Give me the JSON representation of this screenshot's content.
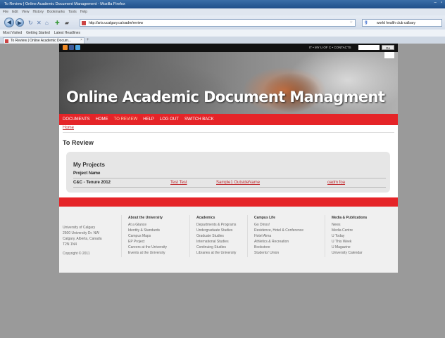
{
  "browser": {
    "window_title": "To Review | Online Academic Document Management - Mozilla Firefox",
    "menu": [
      "File",
      "Edit",
      "View",
      "History",
      "Bookmarks",
      "Tools",
      "Help"
    ],
    "url": "http://arts.ucalgary.ca/oadm/review",
    "search_text": "world health club calbary",
    "bookmarks": [
      "Most Visited",
      "Getting Started",
      "Latest Headlines"
    ],
    "tab_title": "To Review | Online Academic Docum..."
  },
  "site": {
    "top_links": "IT • MY U OF C • CONTACTS",
    "go_label": "Go",
    "title": "Online Academic Document Managment",
    "nav": [
      "DOCUMENTS",
      "HOME",
      "TO REVIEW",
      "HELP",
      "LOG OUT",
      "SWITCH BACK"
    ],
    "active_nav": "TO REVIEW",
    "breadcrumb": "Home",
    "page_title": "To Review",
    "accent": "#e52428"
  },
  "projects": {
    "heading": "My Projects",
    "column_header": "Project Name",
    "rows": [
      {
        "name": "C&C - Tenure 2012",
        "links": [
          "Test Test",
          "Sample1 OutsideName",
          "oadm foa"
        ]
      }
    ]
  },
  "footer": {
    "address": [
      "University of Calgary",
      "2500 University Dr. NW",
      "Calgary, Alberta, Canada",
      "T2N 1N4",
      "",
      "Copyright © 2011"
    ],
    "columns": [
      {
        "heading": "About the University",
        "items": [
          "At a Glance",
          "Identity & Standards",
          "Campus Maps",
          "EP Project",
          "Careers at the University",
          "Events at the University"
        ]
      },
      {
        "heading": "Academics",
        "items": [
          "Departments & Programs",
          "Undergraduate Studies",
          "Graduate Studies",
          "International Studies",
          "Continuing Studies",
          "Libraries at the University"
        ]
      },
      {
        "heading": "Campus Life",
        "items": [
          "Go Dinos!",
          "Residence, Hotel & Conference",
          "Hotel Alma",
          "Athletics & Recreation",
          "Bookstore",
          "Students' Union"
        ]
      },
      {
        "heading": "Media & Publications",
        "items": [
          "News",
          "Media Centre",
          "U Today",
          "U This Week",
          "U Magazine",
          "University Calendar"
        ]
      }
    ]
  }
}
